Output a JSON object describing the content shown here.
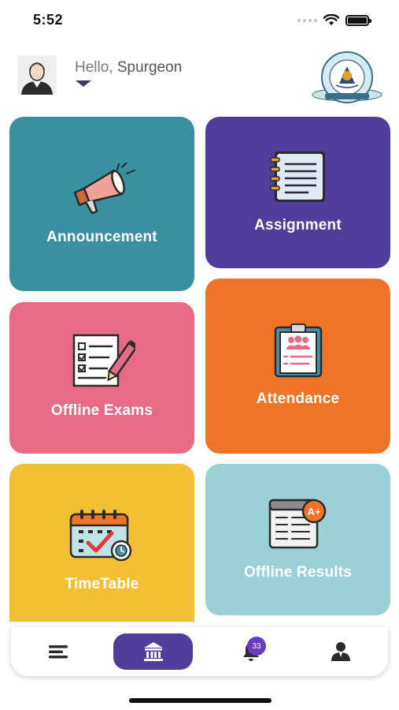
{
  "status_bar": {
    "time": "5:52"
  },
  "header": {
    "greeting": "Hello,",
    "user_name": "Spurgeon",
    "logo_name": "school-logo"
  },
  "tiles": [
    {
      "label": "Announcement",
      "color": "#3a8fa0",
      "icon": "megaphone-icon"
    },
    {
      "label": "Assignment",
      "color": "#4f3d99",
      "icon": "notebook-icon"
    },
    {
      "label": "Offline Exams",
      "color": "#e56b86",
      "icon": "exam-paper-icon"
    },
    {
      "label": "Attendance",
      "color": "#ef7428",
      "icon": "clipboard-attendance-icon"
    },
    {
      "label": "TimeTable",
      "color": "#f3c035",
      "icon": "calendar-icon"
    },
    {
      "label": "Offline Results",
      "color": "#9bd0d7",
      "icon": "result-sheet-icon"
    }
  ],
  "bottom_nav": {
    "items": [
      {
        "name": "menu",
        "icon": "menu-icon"
      },
      {
        "name": "home",
        "icon": "institution-icon",
        "active": true
      },
      {
        "name": "notifications",
        "icon": "bell-icon"
      },
      {
        "name": "profile",
        "icon": "user-icon"
      }
    ],
    "notification_count": "33",
    "accent": "#4f3d99"
  }
}
